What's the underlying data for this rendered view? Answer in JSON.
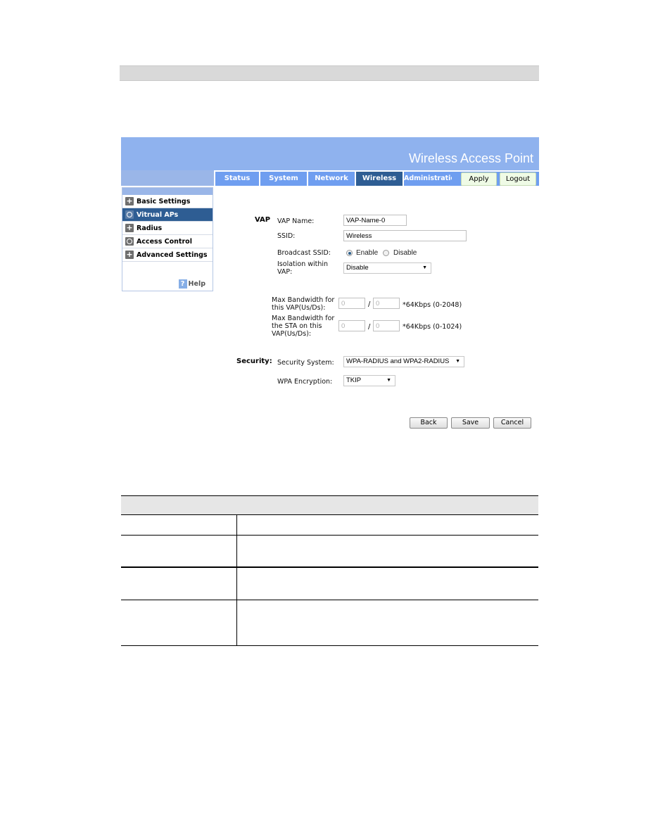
{
  "app": {
    "banner_title": "Wireless Access Point"
  },
  "nav": {
    "tabs": [
      {
        "label": "Status",
        "active": false
      },
      {
        "label": "System",
        "active": false
      },
      {
        "label": "Network",
        "active": false
      },
      {
        "label": "Wireless",
        "active": true
      },
      {
        "label": "Administration",
        "active": false
      }
    ],
    "apply_label": "Apply",
    "logout_label": "Logout"
  },
  "sidebar": {
    "items": [
      {
        "label": "Basic Settings",
        "icon": "plus-icon",
        "active": false
      },
      {
        "label": "Vitrual APs",
        "icon": "circle-icon",
        "active": true
      },
      {
        "label": "Radius",
        "icon": "plus-icon",
        "active": false
      },
      {
        "label": "Access Control",
        "icon": "circle-icon",
        "active": false
      },
      {
        "label": "Advanced Settings",
        "icon": "plus-icon",
        "active": false
      }
    ],
    "help_label": "Help",
    "help_icon": "?"
  },
  "form": {
    "vap_section": "VAP",
    "vap_name_label": "VAP Name:",
    "vap_name_value": "VAP-Name-0",
    "ssid_label": "SSID:",
    "ssid_value": "Wireless",
    "broadcast_label": "Broadcast SSID:",
    "broadcast_options": [
      "Enable",
      "Disable"
    ],
    "broadcast_selected": "Enable",
    "isolation_label_1": "Isolation within",
    "isolation_label_2": "VAP:",
    "isolation_value": "Disable",
    "bw_vap_label_1": "Max Bandwidth for",
    "bw_vap_label_2": "this VAP(Us/Ds):",
    "bw_vap_us": "0",
    "bw_vap_ds": "0",
    "bw_vap_unit": "*64Kbps (0-2048)",
    "bw_sta_label_1": "Max Bandwidth for",
    "bw_sta_label_2": "the STA on this",
    "bw_sta_label_3": "VAP(Us/Ds):",
    "bw_sta_us": "0",
    "bw_sta_ds": "0",
    "bw_sta_unit": "*64Kbps (0-1024)",
    "slash": "/",
    "security_section": "Security:",
    "security_system_label": "Security System:",
    "security_system_value": "WPA-RADIUS and WPA2-RADIUS",
    "wpa_encryption_label": "WPA Encryption:",
    "wpa_encryption_value": "TKIP",
    "caret": "▼",
    "back_label": "Back",
    "save_label": "Save",
    "cancel_label": "Cancel"
  },
  "doc_table": {
    "rows": 4
  }
}
